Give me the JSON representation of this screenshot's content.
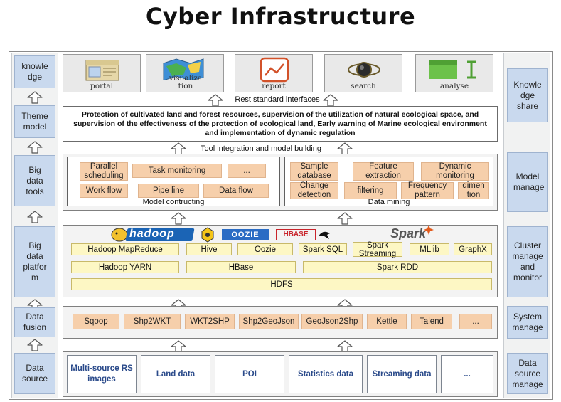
{
  "title": "Cyber Infrastructure",
  "left_layers": [
    "knowle dge",
    "Theme model",
    "Big data tools",
    "Big data platfor m",
    "Data fusion",
    "Data source"
  ],
  "right_layers": [
    "Knowle dge share",
    "Model manage",
    "Cluster manage and monitor",
    "System manage",
    "Data source manage"
  ],
  "apps": [
    "portal",
    "visualiza tion",
    "report",
    "search",
    "analyse"
  ],
  "rest_label": "Rest standard interfaces",
  "theme_text": "Protection of cultivated land and forest resources, supervision of the utilization of natural ecological space, and supervision of the effectiveness of the protection of ecological land, Early warning of Marine ecological environment and implementation of dynamic regulation",
  "tool_label": "Tool integration and model building",
  "model_constructing": {
    "items": [
      "Parallel scheduling",
      "Task monitoring",
      "...",
      "Work flow",
      "Pipe line",
      "Data flow"
    ],
    "label": "Model contructing"
  },
  "data_mining": {
    "items": [
      "Sample database",
      "Feature extraction",
      "Dynamic monitoring",
      "Change detection",
      "filtering",
      "Frequency pattern",
      "dimen tion"
    ],
    "label": "Data mining"
  },
  "platform": {
    "logos": [
      "hadoop",
      "OOZIE",
      "HBASE",
      "Spark"
    ],
    "row1": [
      "Hadoop MapReduce",
      "Hive",
      "Oozie",
      "Spark SQL",
      "Spark Streaming",
      "MLlib",
      "GraphX"
    ],
    "row2": [
      "Hadoop YARN",
      "HBase",
      "Spark RDD"
    ],
    "row3": "HDFS"
  },
  "fusion": [
    "Sqoop",
    "Shp2WKT",
    "WKT2SHP",
    "Shp2GeoJson",
    "GeoJson2Shp",
    "Kettle",
    "Talend",
    "..."
  ],
  "sources": [
    "Multi-source RS images",
    "Land data",
    "POI",
    "Statistics data",
    "Streaming data",
    "..."
  ],
  "colors": {
    "side_box": "#c9d9ee",
    "orange_box": "#f6cfab",
    "yellow_box": "#fdf7c4",
    "source_text": "#2a4a8a"
  }
}
